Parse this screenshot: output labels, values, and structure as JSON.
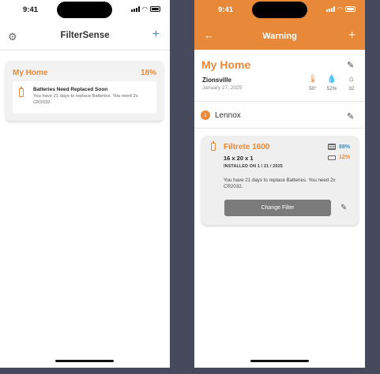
{
  "status_time": "9:41",
  "screen1": {
    "app_title": "FilterSense",
    "settings_icon": "gear-icon",
    "add_icon": "plus-icon",
    "home": {
      "name": "My Home",
      "percent": "18%",
      "alert": {
        "icon": "battery-icon",
        "title": "Batteries Need Replaced Soon",
        "body": "You have 21 days to replace Batteries. You need 2x CR2032."
      }
    }
  },
  "screen2": {
    "nav_title": "Warning",
    "back_icon": "arrow-left-icon",
    "add_icon": "plus-icon",
    "home": {
      "name": "My Home",
      "location": "Zionsville",
      "date": "January 27, 2025",
      "stats": {
        "temperature": "50°",
        "humidity": "52%",
        "air_quality": "32"
      }
    },
    "unit": {
      "number": "1",
      "name": "Lennox"
    },
    "filter": {
      "name": "Filtrete 1600",
      "size": "16 x 20 x 1",
      "installed": "INSTALLED ON  1 / 21 / 2025",
      "filter_level": "88%",
      "battery_level": "12%",
      "message": "You have 21 days to replace Batteries. You need 2x CR2032.",
      "button_label": "Change Filter"
    },
    "colors": {
      "accent": "#e8893a",
      "info": "#3a8fc4"
    }
  }
}
